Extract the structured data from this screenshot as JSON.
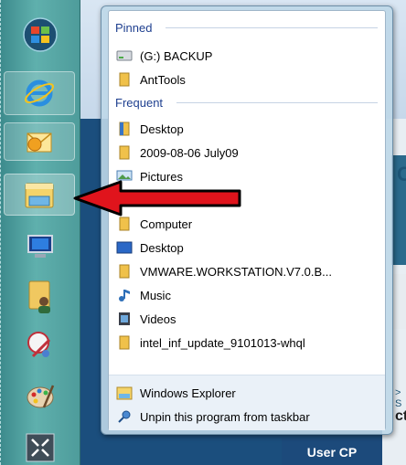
{
  "jumplist": {
    "pinned_header": "Pinned",
    "pinned": [
      {
        "label": "(G:) BACKUP",
        "icon": "drive-icon"
      },
      {
        "label": "AntTools",
        "icon": "folder-icon"
      }
    ],
    "frequent_header": "Frequent",
    "frequent": [
      {
        "label": "Desktop",
        "icon": "desktop-folder-icon"
      },
      {
        "label": "2009-08-06 July09",
        "icon": "folder-icon"
      },
      {
        "label": "Pictures",
        "icon": "pictures-icon"
      },
      {
        "label": "Computer",
        "icon": "folder-icon"
      },
      {
        "label": "Desktop",
        "icon": "desktop-icon"
      },
      {
        "label": "VMWARE.WORKSTATION.V7.0.B...",
        "icon": "folder-icon"
      },
      {
        "label": "Music",
        "icon": "music-icon"
      },
      {
        "label": "Videos",
        "icon": "videos-icon"
      },
      {
        "label": "intel_inf_update_9101013-whql",
        "icon": "folder-icon"
      }
    ],
    "tasks": [
      {
        "label": "Windows Explorer",
        "icon": "explorer-icon"
      },
      {
        "label": "Unpin this program from taskbar",
        "icon": "unpin-icon"
      }
    ]
  },
  "background_window": {
    "user_cp": "User CP",
    "right_letter": "C",
    "right_small": "> S",
    "right_partial": "ct"
  },
  "taskbar": {
    "icons": [
      "windows-start-icon",
      "internet-explorer-icon",
      "outlook-icon",
      "windows-explorer-icon",
      "computer-icon",
      "user-folder-icon",
      "paint-tool-icon",
      "palette-icon",
      "arrows-icon"
    ]
  },
  "colors": {
    "header_text": "#1e3f8f",
    "arrow": "#e0141c",
    "taskbar": "#4e9c9b"
  }
}
